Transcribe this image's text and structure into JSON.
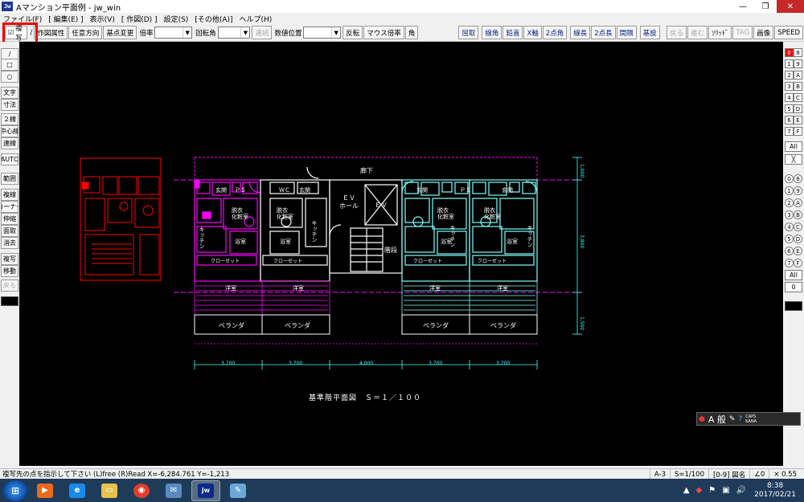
{
  "window": {
    "title": "Aマンション平面例 - jw_win",
    "app_icon": "Jw"
  },
  "menu": [
    "ファイル(F)",
    "[ 編集(E) ]",
    "表示(V)",
    "[ 作図(D) ]",
    "設定(S)",
    "[その他(A)]",
    "ヘルプ(H)"
  ],
  "toolbar": {
    "copy_check": "複写",
    "slash": "/",
    "btn_attr": "作図属性",
    "btn_dir": "任意方向",
    "btn_base": "基点変更",
    "label_scale": "倍率",
    "label_rotate": "回転角",
    "btn_continue": "連続",
    "label_count": "数値位置",
    "btn_flip": "反転",
    "btn_mouse": "マウス倍率",
    "btn_kaku": "角",
    "right_buttons": [
      "屈取",
      "線角",
      "鉛直",
      "X軸",
      "2点角",
      "線長",
      "2点長",
      "間隔",
      "基設",
      "戻る",
      "進む",
      "ｿﾘｯﾄﾞ",
      "TAG",
      "画像",
      "SPEED"
    ]
  },
  "left_tools": [
    "/",
    "□",
    "○",
    "文字",
    "寸法",
    "２線",
    "中心線",
    "連線",
    "AUTO",
    "範囲",
    "複線",
    "コーナー",
    "伸縮",
    "面取",
    "消去",
    "複写",
    "移動",
    "戻る"
  ],
  "right_tools": {
    "layer_rows": [
      [
        "0",
        "8"
      ],
      [
        "1",
        "9"
      ],
      [
        "2",
        "A"
      ],
      [
        "3",
        "B"
      ],
      [
        "4",
        "C"
      ],
      [
        "5",
        "D"
      ],
      [
        "6",
        "E"
      ],
      [
        "7",
        "F"
      ]
    ],
    "all_label": "All",
    "group_rows": [
      [
        "0",
        "8"
      ],
      [
        "1",
        "9"
      ],
      [
        "2",
        "A"
      ],
      [
        "3",
        "B"
      ],
      [
        "4",
        "C"
      ],
      [
        "5",
        "D"
      ],
      [
        "6",
        "E"
      ],
      [
        "7",
        "F"
      ]
    ],
    "all2_label": "All",
    "zero_label": "0"
  },
  "drawing": {
    "title_text": "基準階平面図　Ｓ＝１／１００",
    "labels": {
      "corridor": "廊下",
      "ev_hall": "ＥＶ\nホール",
      "ev": "ＥＶ",
      "stairs": "階段",
      "entrance": "玄関",
      "ps": "ＰＳ",
      "wc": "ＷＣ",
      "dressing": "脱衣\n化粧室",
      "bath": "浴室",
      "kitchen": "キッチン",
      "closet": "クローゼット",
      "western": "洋室",
      "veranda": "ベランダ"
    },
    "dims_bottom": [
      "3,700",
      "3,700",
      "4,000",
      "3,700",
      "3,700"
    ],
    "dims_right": [
      "1,000",
      "3,800",
      "1,500"
    ]
  },
  "ime": {
    "mode": "A 般",
    "caps": "CAPS\nKANA"
  },
  "status": {
    "message": "複写先の点を指示して下さい (L)free (R)Read X=-6,284.761 Y=-1,213",
    "cells": [
      "A-3",
      "S=1/100",
      "[0-9] 図名",
      "∠0",
      "× 0.55"
    ]
  },
  "taskbar": {
    "time": "8:38",
    "date": "2017/02/21"
  },
  "colors": {
    "magenta": "#ff00ff",
    "cyan": "#7fffff",
    "red": "#ff0000",
    "white": "#ffffff",
    "dim": "#40ffff"
  }
}
